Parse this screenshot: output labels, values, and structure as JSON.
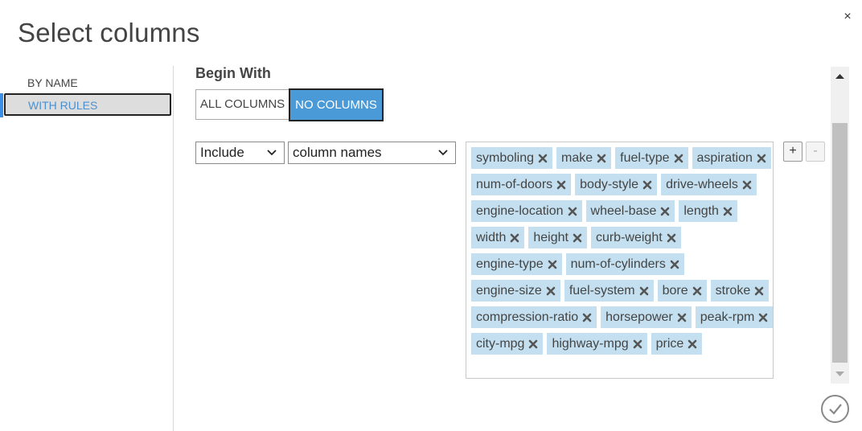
{
  "dialog": {
    "title": "Select columns",
    "close_glyph": "×"
  },
  "sidebar": {
    "items": [
      {
        "label": "BY NAME",
        "selected": false
      },
      {
        "label": "WITH RULES",
        "selected": true
      }
    ]
  },
  "begin_with": {
    "label": "Begin With",
    "options": [
      {
        "label": "ALL COLUMNS",
        "selected": false
      },
      {
        "label": "NO COLUMNS",
        "selected": true
      }
    ]
  },
  "rule": {
    "mode_value": "Include",
    "target_value": "column names",
    "add_label": "+",
    "remove_label": "-",
    "columns": [
      [
        "symboling",
        "make",
        "fuel-type",
        "aspiration"
      ],
      [
        "num-of-doors",
        "body-style",
        "drive-wheels"
      ],
      [
        "engine-location",
        "wheel-base",
        "length"
      ],
      [
        "width",
        "height",
        "curb-weight"
      ],
      [
        "engine-type",
        "num-of-cylinders"
      ],
      [
        "engine-size",
        "fuel-system",
        "bore",
        "stroke"
      ],
      [
        "compression-ratio",
        "horsepower",
        "peak-rpm"
      ],
      [
        "city-mpg",
        "highway-mpg",
        "price"
      ]
    ]
  },
  "icons": {
    "close": "close-icon",
    "chevron": "chevron-down-icon",
    "tag_remove": "remove-tag-icon",
    "scroll_up": "scroll-up-arrow-icon",
    "scroll_down": "scroll-down-arrow-icon",
    "ok": "checkmark-icon"
  },
  "colors": {
    "accent": "#4a9ad8",
    "tag_bg": "#c4e0f0",
    "selected_text": "#4a90d0"
  }
}
